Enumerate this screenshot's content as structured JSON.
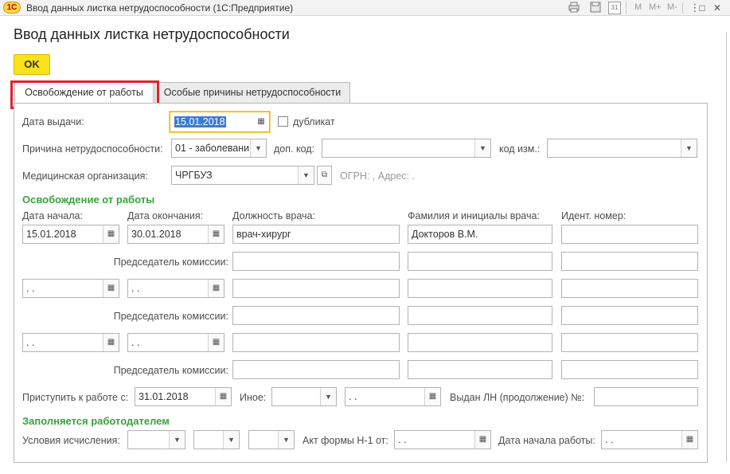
{
  "window": {
    "app_logo": "1С",
    "title": "Ввод данных листка нетрудоспособности  (1С:Предприятие)",
    "toolbar": {
      "m": "M",
      "m_plus": "M+",
      "m_minus": "M-",
      "calendar_day": "31",
      "more": "⋮",
      "minimize": "—",
      "maximize": "□",
      "close": "✕"
    }
  },
  "form": {
    "heading": "Ввод данных листка нетрудоспособности",
    "ok_label": "OK"
  },
  "tabs": [
    {
      "label": "Освобождение от работы",
      "active": true
    },
    {
      "label": "Особые причины нетрудоспособности",
      "active": false
    }
  ],
  "fields": {
    "issue_date_label": "Дата выдачи:",
    "issue_date": "15.01.2018",
    "duplicate_label": "дубликат",
    "reason_label": "Причина нетрудоспособности:",
    "reason_value": "01 - заболевани",
    "extra_code_label": "доп. код:",
    "extra_code_value": "",
    "change_code_label": "код изм.:",
    "change_code_value": "",
    "med_org_label": "Медицинская организация:",
    "med_org_value": "ЧРГБУЗ",
    "ogrn_text": "ОГРН: , Адрес: ."
  },
  "release": {
    "section_title": "Освобождение от работы",
    "col_start": "Дата начала:",
    "col_end": "Дата окончания:",
    "col_doctor_position": "Должность врача:",
    "col_doctor_name": "Фамилия и инициалы врача:",
    "col_ident": "Идент.  номер:",
    "chairman_label": "Председатель комиссии:",
    "rows": [
      {
        "start": "15.01.2018",
        "end": "30.01.2018",
        "position": "врач-хирург",
        "doctor": "Докторов В.М.",
        "ident": ""
      },
      {
        "start": " .  .",
        "end": " .  .",
        "position": "",
        "doctor": "",
        "ident": ""
      },
      {
        "start": " .  .",
        "end": " .  .",
        "position": "",
        "doctor": "",
        "ident": ""
      }
    ]
  },
  "bottom": {
    "return_label": "Приступить к работе с:",
    "return_date": "31.01.2018",
    "other_label": "Иное:",
    "other_value": "",
    "other_date": " .  .",
    "issued_ln_label": "Выдан ЛН (продолжение) №:",
    "issued_ln_value": ""
  },
  "employer": {
    "section_title": "Заполняется работодателем",
    "conditions_label": "Условия исчисления:",
    "act_label": "Акт формы Н-1 от:",
    "act_date": " .  .",
    "work_start_label": "Дата начала работы:",
    "work_start_date": " .  ."
  },
  "icons": {
    "calendar": "calendar-icon",
    "dropdown": "dropdown-arrow-icon",
    "open": "open-link-icon",
    "print": "print-icon",
    "save": "save-icon"
  }
}
